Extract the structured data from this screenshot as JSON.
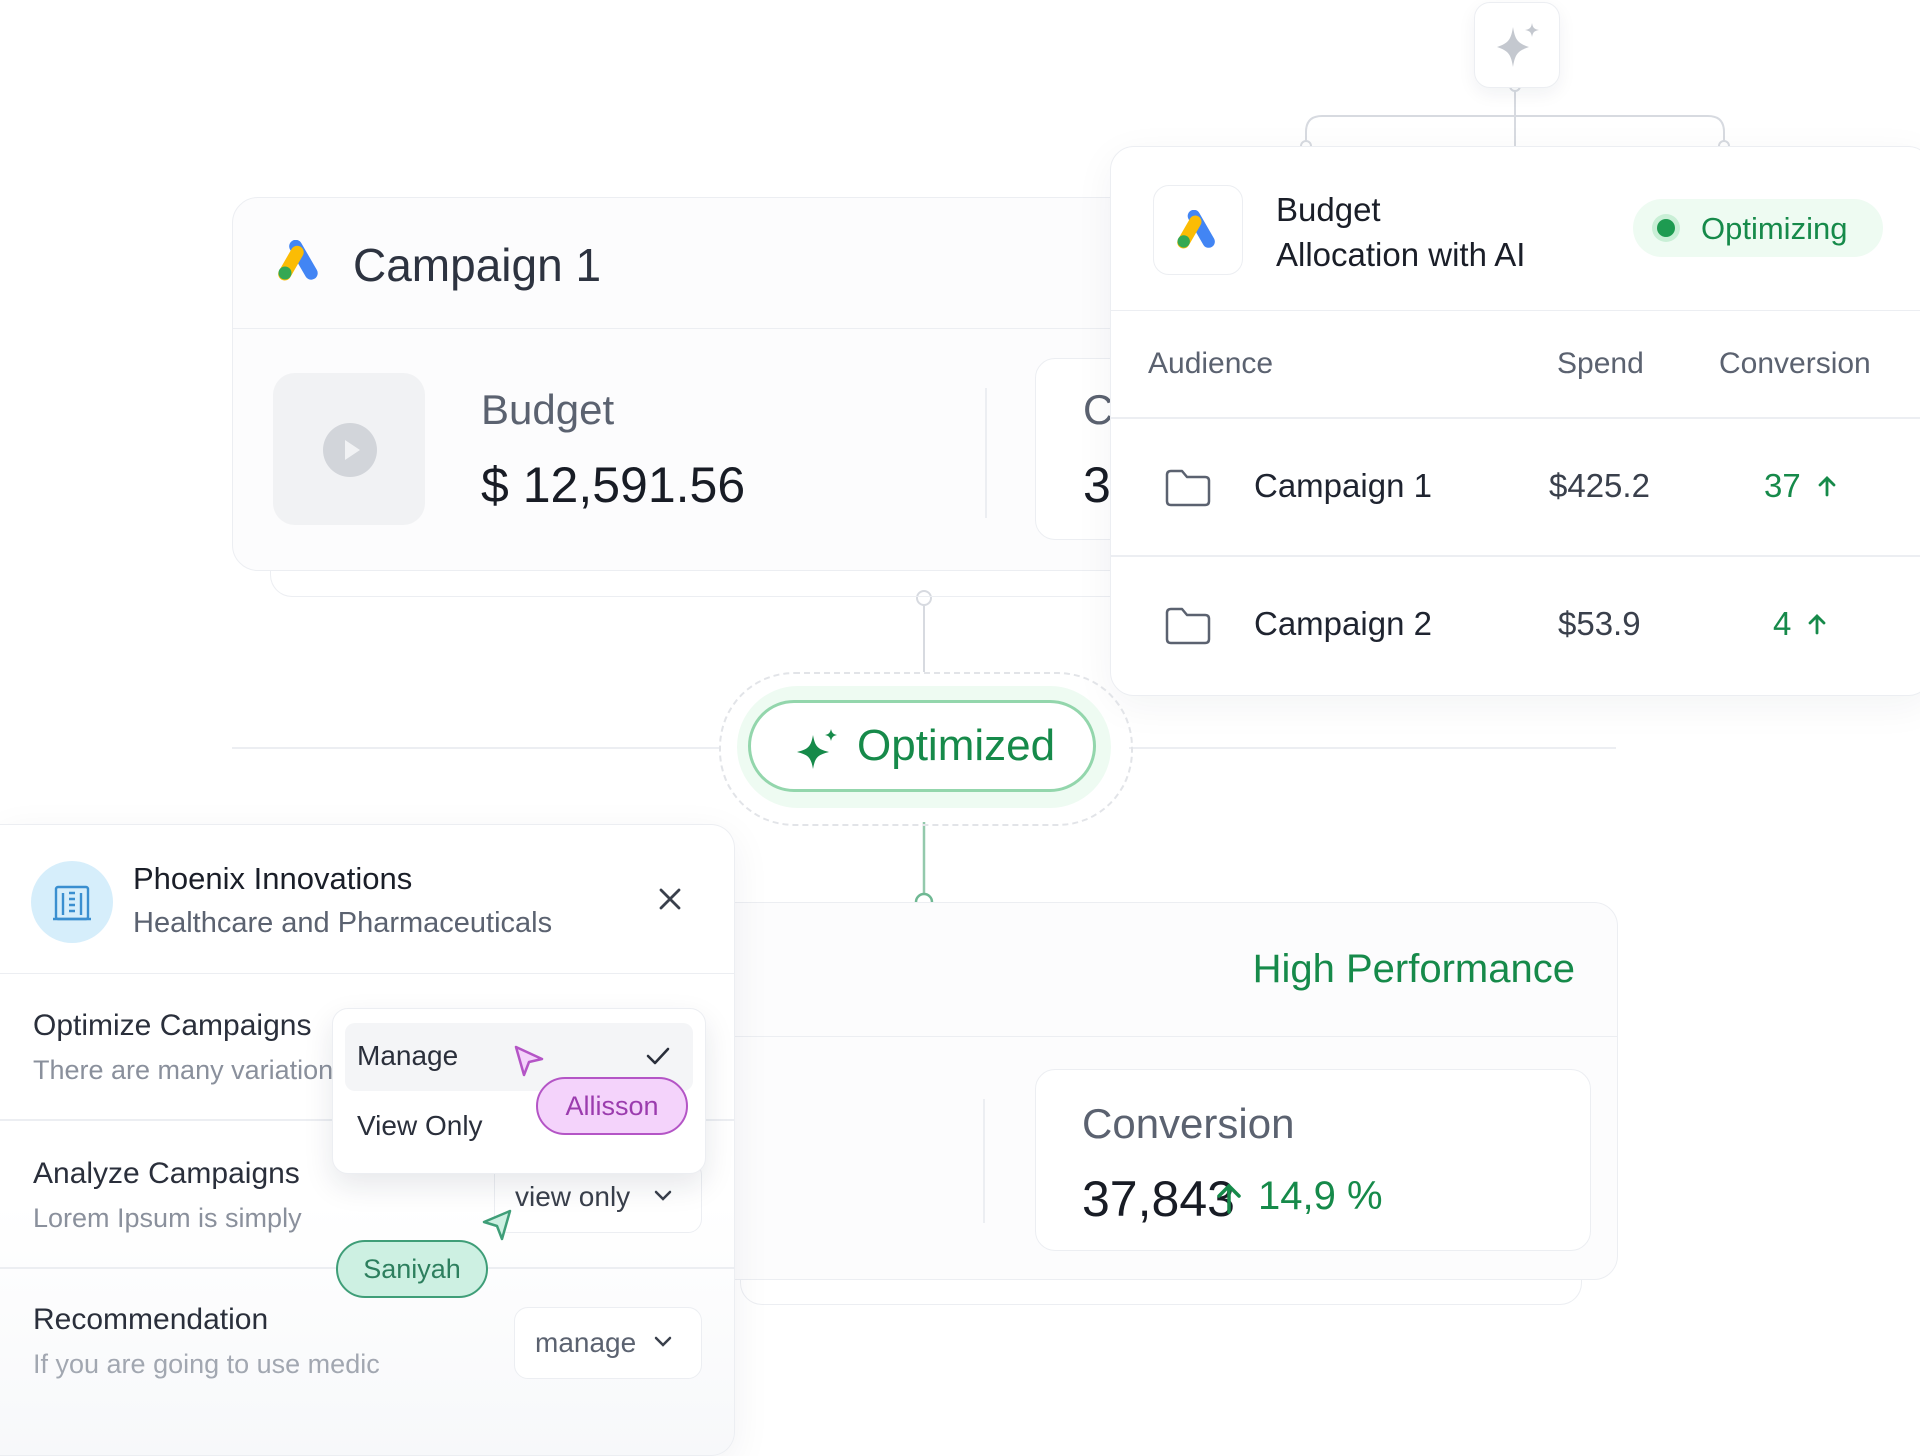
{
  "ai_button": {
    "icon": "sparkle-icon"
  },
  "campaign_card": {
    "title": "Campaign 1",
    "budget_label": "Budget",
    "budget_value": "$ 12,591.56",
    "secondary_label": "C",
    "secondary_value": "3"
  },
  "allocation": {
    "title_line1": "Budget",
    "title_line2": "Allocation with AI",
    "status": "Optimizing",
    "columns": [
      "Audience",
      "Spend",
      "Conversion"
    ],
    "rows": [
      {
        "audience": "Campaign 1",
        "spend": "$425.2",
        "conversion": "37"
      },
      {
        "audience": "Campaign 2",
        "spend": "$53.9",
        "conversion": "4"
      }
    ]
  },
  "badge": {
    "label": "Optimized"
  },
  "performance": {
    "title": "High Performance",
    "conversion_label": "Conversion",
    "conversion_value": "37,843",
    "conversion_delta": "14,9 %"
  },
  "company": {
    "name": "Phoenix Innovations",
    "industry": "Healthcare and Pharmaceuticals",
    "permissions": [
      {
        "title": "Optimize Campaigns",
        "description": "There are many variation",
        "value": "Manage"
      },
      {
        "title": "Analyze Campaigns",
        "description": "Lorem Ipsum is simply",
        "value": "view only"
      },
      {
        "title": "Recommendation",
        "description": "If you are going to use medic",
        "value": "manage"
      }
    ],
    "dropdown_options": [
      "Manage",
      "View Only"
    ]
  },
  "cursors": [
    {
      "name": "Allisson",
      "color": "#b455c6",
      "fill": "#f4d3fb"
    },
    {
      "name": "Saniyah",
      "color": "#3f9e78",
      "fill": "#cdf0e2"
    }
  ],
  "colors": {
    "accent_green": "#168a4a",
    "google_blue": "#4285F4",
    "google_yellow": "#FBBC04",
    "google_green": "#34A853"
  }
}
